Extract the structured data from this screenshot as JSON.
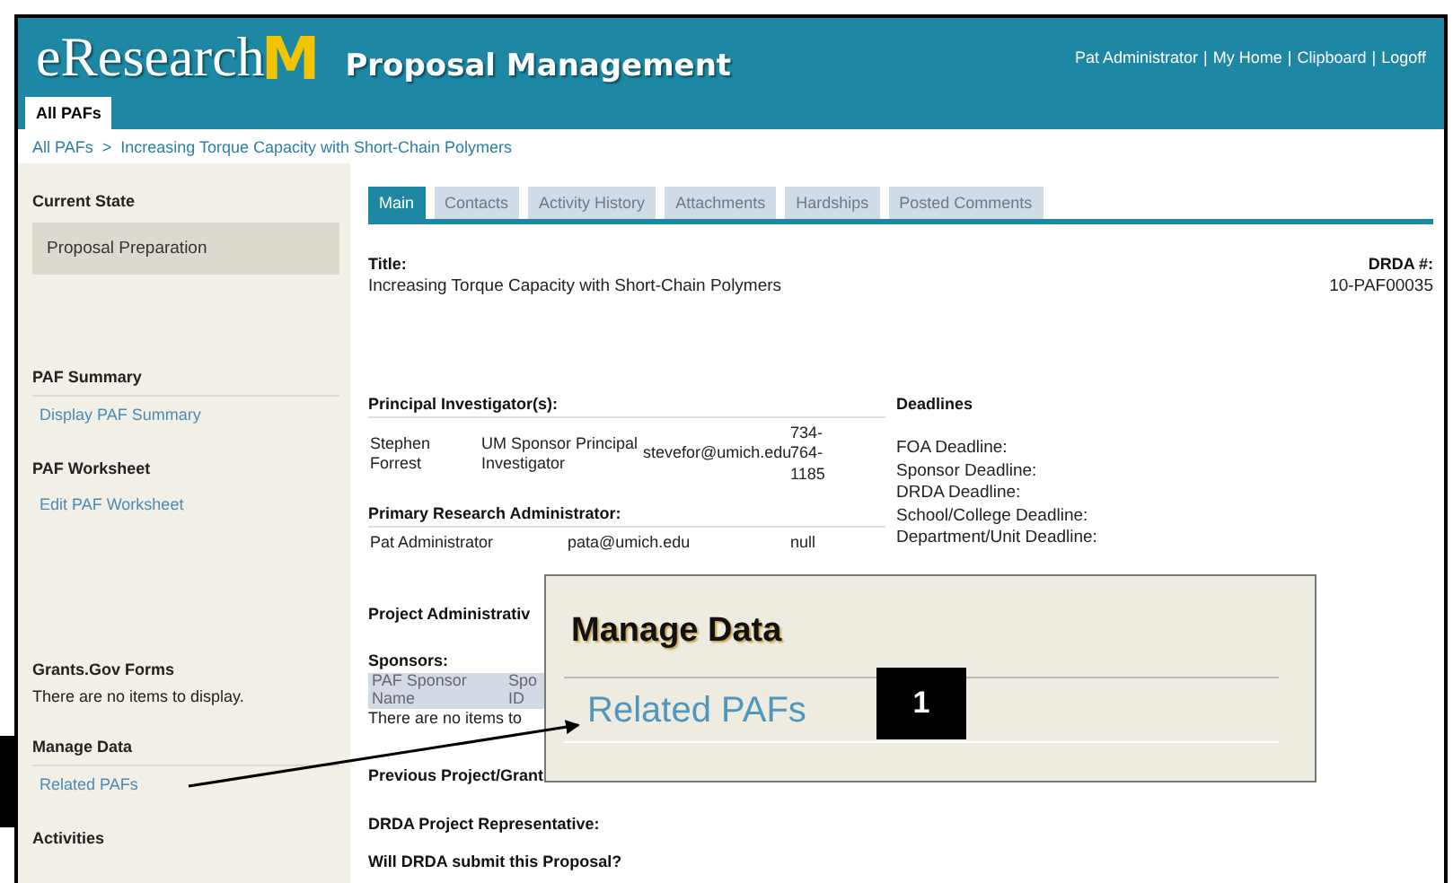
{
  "header": {
    "logo_text": "eResearch",
    "logo_letter": "M",
    "app_title": "Proposal Management",
    "separator": "|",
    "user_links": [
      "Pat Administrator",
      "My Home",
      "Clipboard",
      "Logoff"
    ]
  },
  "nav_tabs": [
    {
      "label": "All PAFs",
      "selected": true
    }
  ],
  "breadcrumb": {
    "items": [
      "All PAFs",
      "Increasing Torque Capacity with Short-Chain Polymers"
    ],
    "separator": ">"
  },
  "sidebar": [
    {
      "kind": "state",
      "heading": "Current State",
      "items": [
        "Proposal Preparation"
      ]
    },
    {
      "kind": "links",
      "heading": "PAF Summary",
      "items": [
        "Display PAF Summary"
      ]
    },
    {
      "kind": "plain",
      "heading": "PAF Worksheet",
      "items": [
        "Edit PAF Worksheet"
      ]
    },
    {
      "kind": "message",
      "heading": "Grants.Gov Forms",
      "items": [
        "There are no items to display."
      ]
    },
    {
      "kind": "links",
      "heading": "Manage Data",
      "items": [
        "Related PAFs"
      ]
    },
    {
      "kind": "plain",
      "heading": "Activities"
    }
  ],
  "tabs": [
    {
      "label": "Main",
      "selected": true
    },
    {
      "label": "Contacts",
      "selected": false
    },
    {
      "label": "Activity History",
      "selected": false
    },
    {
      "label": "Attachments",
      "selected": false
    },
    {
      "label": "Hardships",
      "selected": false
    },
    {
      "label": "Posted Comments",
      "selected": false
    }
  ],
  "title": {
    "label": "Title:",
    "value": "Increasing Torque Capacity with Short-Chain Polymers"
  },
  "drda_number": {
    "label": "DRDA #:",
    "value": "10-PAF00035"
  },
  "principal_investigators": {
    "label": "Principal Investigator(s):",
    "rows": [
      [
        "Stephen Forrest",
        "UM Sponsor Principal Investigator",
        "stevefor@umich.edu",
        "734-764-1185"
      ]
    ]
  },
  "primary_research_administrator": {
    "label": "Primary Research Administrator:",
    "rows": [
      [
        "Pat Administrator",
        "pata@umich.edu",
        "null"
      ]
    ]
  },
  "deadlines": {
    "label": "Deadlines",
    "items": [
      "FOA Deadline:",
      "Sponsor Deadline:",
      "DRDA Deadline:",
      "School/College Deadline:",
      "Department/Unit Deadline:"
    ]
  },
  "project_administrator": {
    "label": "Project Administrativ"
  },
  "sponsors": {
    "label": "Sponsors:",
    "columns": [
      "PAF Sponsor Name",
      "Spo ID"
    ],
    "empty_message": "There are no items to"
  },
  "previous_project": {
    "label": "Previous Project/Grant"
  },
  "drda_representative": {
    "label": "DRDA Project Representative:"
  },
  "question": {
    "label": "Will DRDA submit this Proposal?"
  },
  "callout": {
    "heading": "Manage Data",
    "link": "Related PAFs",
    "number": "1"
  }
}
